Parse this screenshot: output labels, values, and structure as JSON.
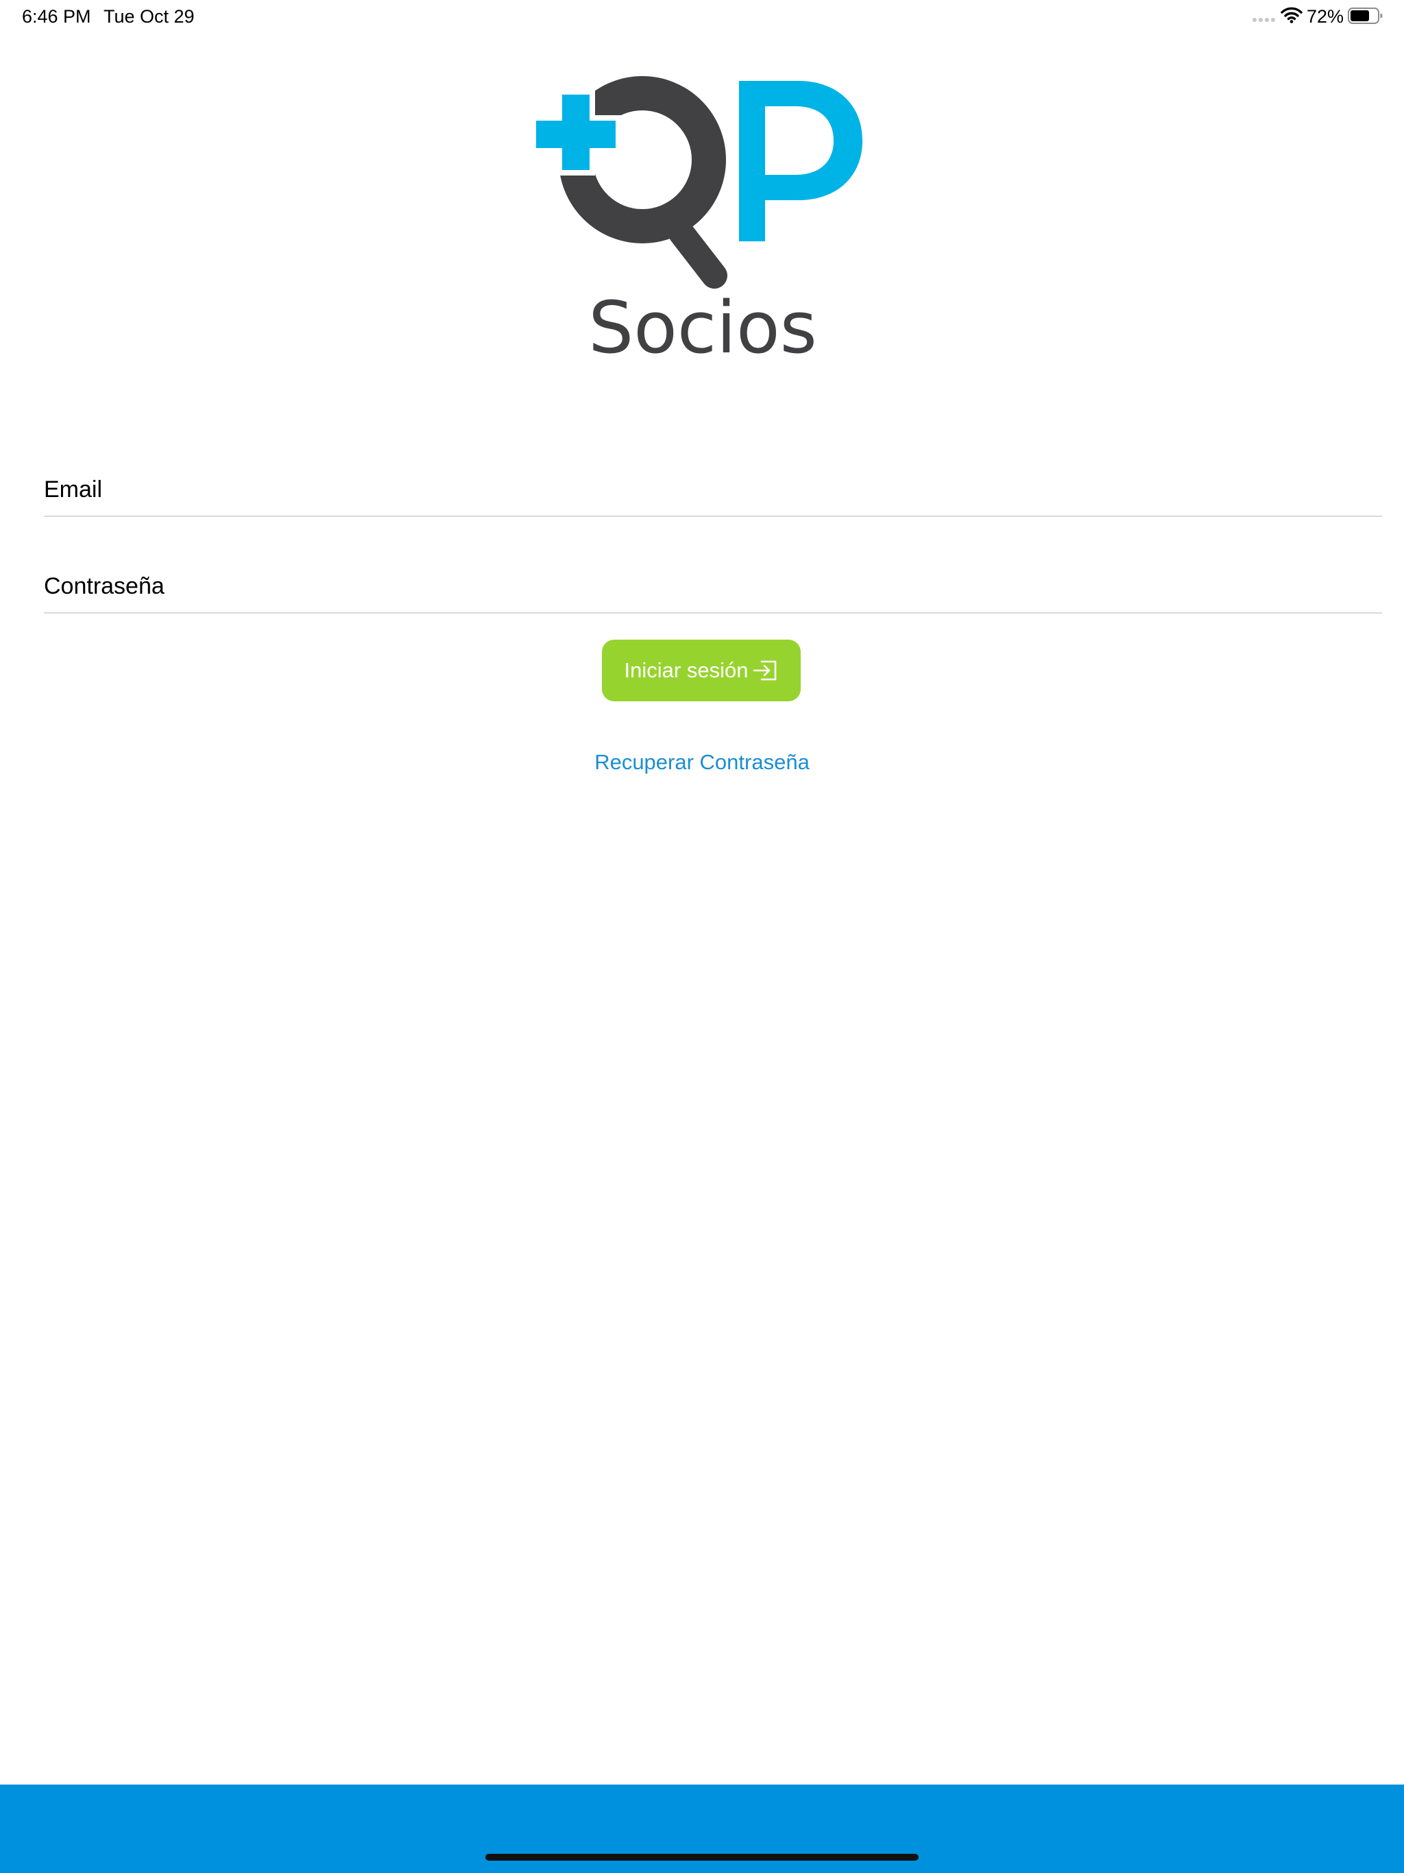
{
  "status_bar": {
    "time": "6:46 PM",
    "date": "Tue Oct 29",
    "battery_percent": "72%",
    "battery_level": 0.72,
    "icons": [
      "cellular-dots-icon",
      "wifi-icon",
      "battery-icon"
    ]
  },
  "logo": {
    "brand_text": "Socios",
    "colors": {
      "blue": "#00b3e6",
      "dark": "#414143"
    }
  },
  "form": {
    "email": {
      "value": "",
      "placeholder": "Email"
    },
    "password": {
      "value": "",
      "placeholder": "Contraseña"
    },
    "login_button": {
      "label": "Iniciar sesión",
      "icon": "sign-in-icon",
      "color": "#97d32e"
    },
    "recover_link": {
      "label": "Recuperar Contraseña",
      "color": "#1a8ed3"
    }
  },
  "footer": {
    "color": "#0091de"
  }
}
